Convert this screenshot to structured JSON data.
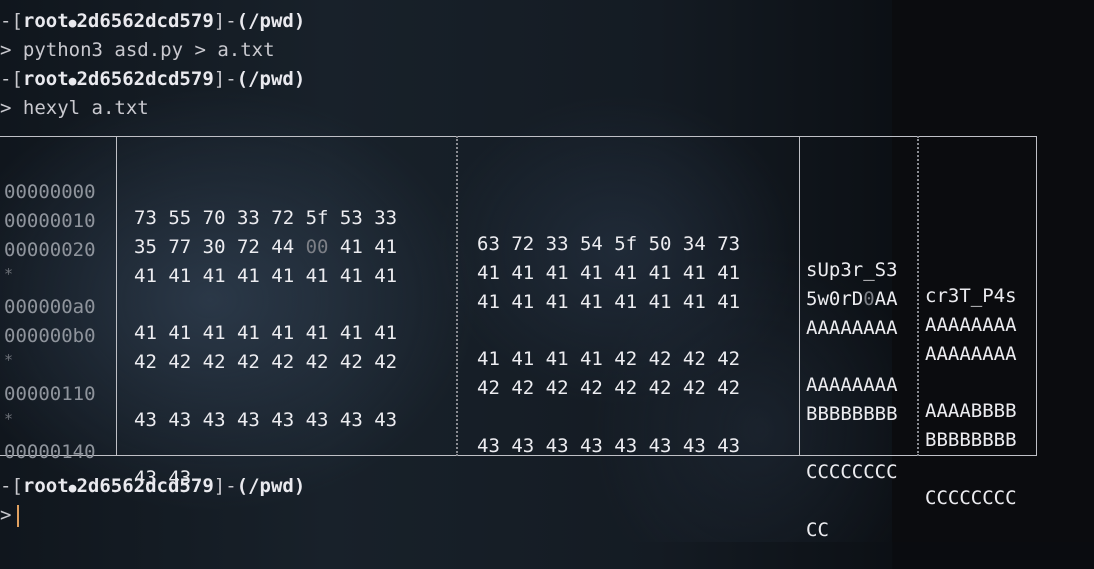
{
  "terminal": {
    "prompt_user": "root",
    "prompt_sep": "●",
    "prompt_host": "2d6562dcd579",
    "prompt_dir": "(/pwd)",
    "arrow": ">",
    "commands": [
      "python3 asd.py > a.txt",
      "hexyl a.txt",
      ""
    ],
    "cursor_color": "#e0a060"
  },
  "hexdump": {
    "rows": [
      {
        "offset": "00000000",
        "hex1": "73 55 70 33 72 5f 53 33",
        "hex2": "63 72 33 54 5f 50 34 73",
        "ascii1": "sUp3r_S3",
        "ascii2": "cr3T_P4s"
      },
      {
        "offset": "00000010",
        "hex1a": "35 77 30 72 44 ",
        "hex1z": "00",
        "hex1b": " 41 41",
        "hex2": "41 41 41 41 41 41 41 41",
        "ascii1a": "5w0rD",
        "ascii1z": "0",
        "ascii1b": "AA",
        "ascii2": "AAAAAAAA"
      },
      {
        "offset": "00000020",
        "hex1": "41 41 41 41 41 41 41 41",
        "hex2": "41 41 41 41 41 41 41 41",
        "ascii1": "AAAAAAAA",
        "ascii2": "AAAAAAAA"
      },
      {
        "star": "*"
      },
      {
        "offset": "000000a0",
        "hex1": "41 41 41 41 41 41 41 41",
        "hex2": "41 41 41 41 42 42 42 42",
        "ascii1": "AAAAAAAA",
        "ascii2": "AAAABBBB"
      },
      {
        "offset": "000000b0",
        "hex1": "42 42 42 42 42 42 42 42",
        "hex2": "42 42 42 42 42 42 42 42",
        "ascii1": "BBBBBBBB",
        "ascii2": "BBBBBBBB"
      },
      {
        "star": "*"
      },
      {
        "offset": "00000110",
        "hex1": "43 43 43 43 43 43 43 43",
        "hex2": "43 43 43 43 43 43 43 43",
        "ascii1": "CCCCCCCC",
        "ascii2": "CCCCCCCC"
      },
      {
        "star": "*"
      },
      {
        "offset": "00000140",
        "hex1": "43 43",
        "hex2": "",
        "ascii1": "CC",
        "ascii2": ""
      }
    ]
  }
}
